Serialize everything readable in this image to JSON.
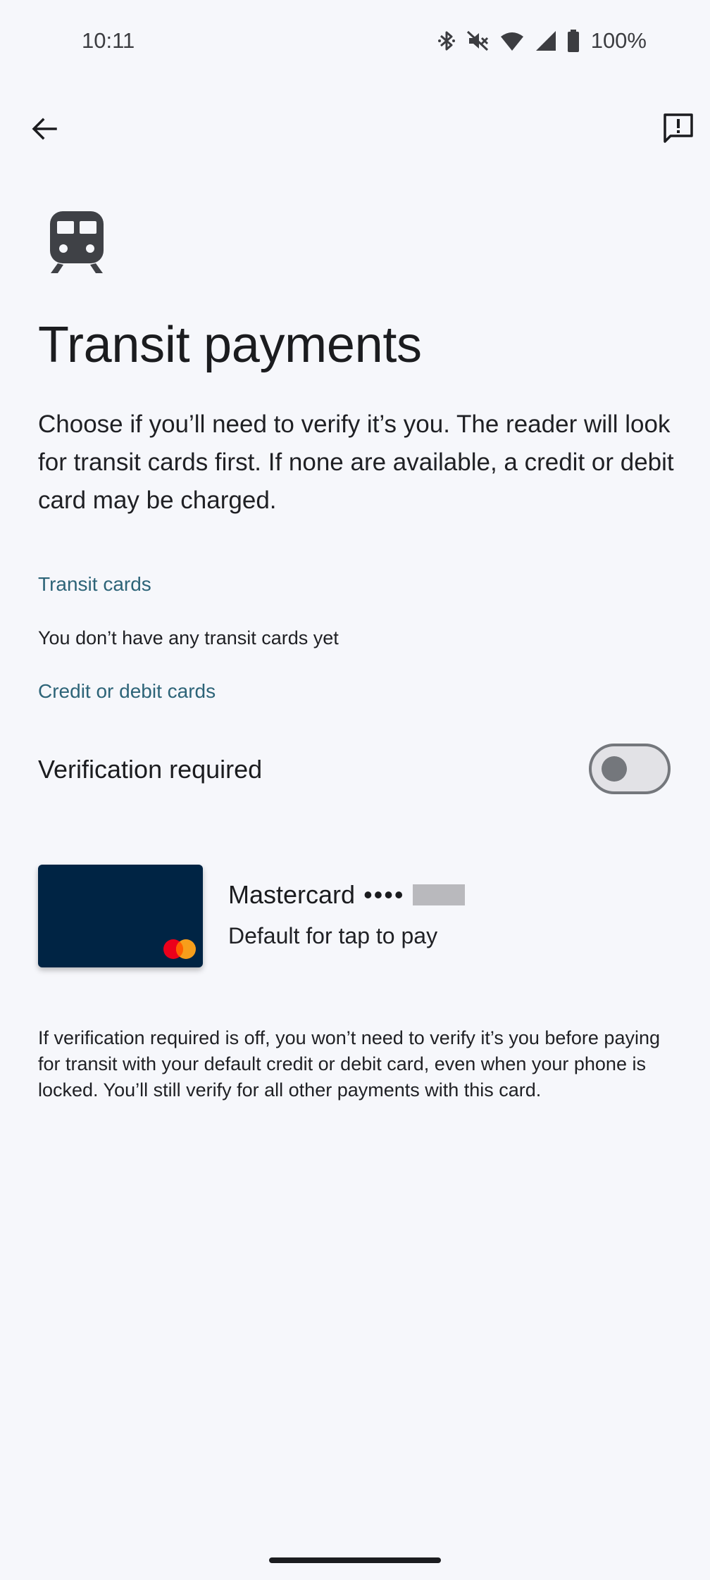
{
  "status_bar": {
    "time": "10:11",
    "battery_text": "100%",
    "icons": [
      "bluetooth-icon",
      "mute-icon",
      "wifi-icon",
      "cell-signal-icon",
      "battery-icon"
    ]
  },
  "top_bar": {
    "back_icon": "arrow-back-icon",
    "feedback_icon": "feedback-icon"
  },
  "hero": {
    "icon": "train-icon",
    "title": "Transit payments",
    "description": "Choose if you’ll need to verify it’s you. The reader will look for transit cards first. If none are available, a credit or debit card may be charged."
  },
  "transit_section": {
    "header": "Transit cards",
    "empty_text": "You don’t have any transit cards yet"
  },
  "credit_section": {
    "header": "Credit or debit cards",
    "verification_label": "Verification required",
    "verification_enabled": false
  },
  "card": {
    "name": "Mastercard",
    "dots": "••••",
    "subtitle": "Default for tap to pay",
    "art_color": "#002444",
    "brand_icon": "mastercard-logo-icon"
  },
  "footnote": "If verification required is off, you won’t need to verify it’s you before paying for transit with your default credit or debit card, even when your phone is locked. You’ll still verify for all other payments with this card.",
  "colors": {
    "background": "#f6f7fb",
    "section_header": "#2d6478",
    "text": "#1b1c1f"
  }
}
